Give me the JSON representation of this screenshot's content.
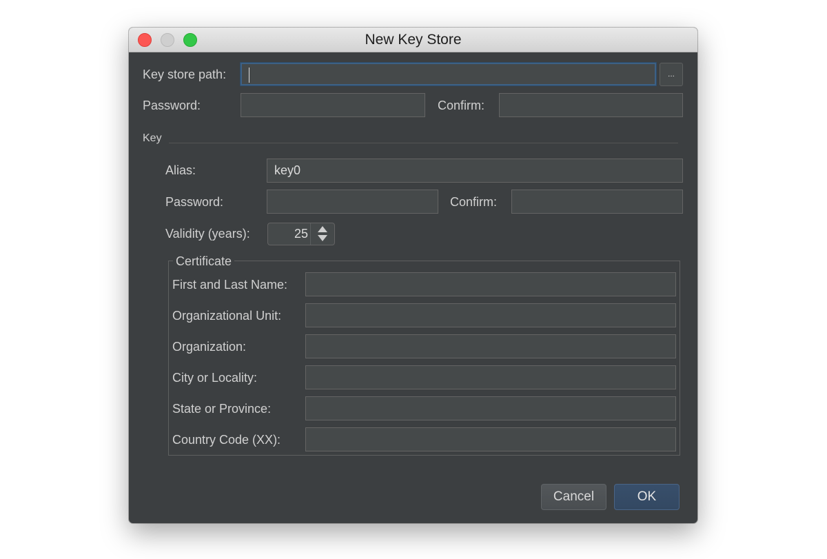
{
  "window": {
    "title": "New Key Store"
  },
  "keystore": {
    "path_label": "Key store path:",
    "path_value": "",
    "browse_label": "...",
    "password_label": "Password:",
    "confirm_label": "Confirm:"
  },
  "key": {
    "section_label": "Key",
    "alias_label": "Alias:",
    "alias_value": "key0",
    "password_label": "Password:",
    "confirm_label": "Confirm:",
    "validity_label": "Validity (years):",
    "validity_value": "25"
  },
  "certificate": {
    "legend": "Certificate",
    "fields": [
      {
        "label": "First and Last Name:",
        "value": ""
      },
      {
        "label": "Organizational Unit:",
        "value": ""
      },
      {
        "label": "Organization:",
        "value": ""
      },
      {
        "label": "City or Locality:",
        "value": ""
      },
      {
        "label": "State or Province:",
        "value": ""
      },
      {
        "label": "Country Code (XX):",
        "value": ""
      }
    ]
  },
  "buttons": {
    "cancel": "Cancel",
    "ok": "OK"
  },
  "colors": {
    "window_bg": "#3c3f41",
    "field_bg": "#45494a",
    "focus_border": "#3d6185",
    "ok_button": "#384f6b",
    "close_button": "#fc5753",
    "maximize_button": "#33c748"
  },
  "icons": {
    "close": "close-icon",
    "minimize": "minimize-icon",
    "maximize": "maximize-icon",
    "spin_up": "arrow-up-icon",
    "spin_down": "arrow-down-icon"
  }
}
